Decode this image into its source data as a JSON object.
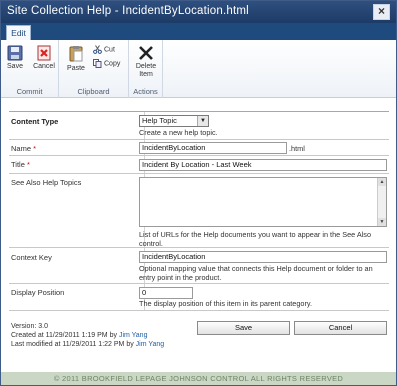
{
  "window": {
    "title": "Site Collection Help - IncidentByLocation.html"
  },
  "tabs": [
    {
      "label": "Edit"
    }
  ],
  "ribbon": {
    "commit": {
      "label": "Commit",
      "save": "Save",
      "cancel": "Cancel"
    },
    "clipboard": {
      "label": "Clipboard",
      "paste": "Paste",
      "cut": "Cut",
      "copy": "Copy"
    },
    "actions": {
      "label": "Actions",
      "delete_line1": "Delete",
      "delete_line2": "Item"
    }
  },
  "form": {
    "content_type": {
      "label": "Content Type",
      "value": "Help Topic",
      "desc": "Create a new help topic."
    },
    "name": {
      "label": "Name",
      "required": "*",
      "value": "IncidentByLocation",
      "suffix": ".html"
    },
    "title": {
      "label": "Title",
      "required": "*",
      "value": "Incident By Location - Last Week"
    },
    "see_also": {
      "label": "See Also Help Topics",
      "value": "",
      "desc": "List of URLs for the Help documents you want to appear in the See Also control."
    },
    "context_key": {
      "label": "Context Key",
      "value": "IncidentByLocation",
      "desc": "Optional mapping value that connects this Help document or folder to an entry point in the product."
    },
    "display_position": {
      "label": "Display Position",
      "value": "0",
      "desc": "The display position of this item in its parent category."
    }
  },
  "meta": {
    "version": "Version: 3.0",
    "created_prefix": "Created at 11/29/2011 1:19 PM  by ",
    "created_by": "Jim Yang",
    "modified_prefix": "Last modified at 11/29/2011 1:22 PM  by ",
    "modified_by": "Jim Yang"
  },
  "buttons": {
    "save": "Save",
    "cancel": "Cancel"
  },
  "footer": {
    "copyright": "© 2011 BROOKFIELD LEPAGE JOHNSON CONTROL ALL RIGHTS RESERVED"
  },
  "colors": {
    "titlebar": "#1d3b66",
    "accent": "#1f4a7d",
    "required": "#cc0000",
    "link": "#1f5ea8",
    "footer_bg": "#cad7c4"
  }
}
